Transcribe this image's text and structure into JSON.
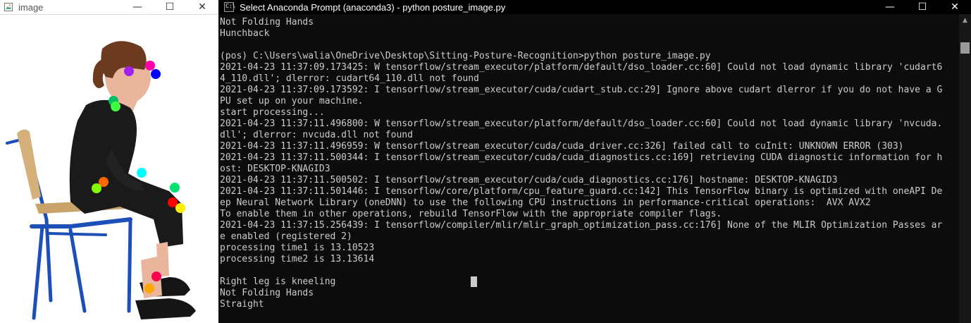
{
  "image_window": {
    "title": "image",
    "controls": {
      "minimize": "—",
      "maximize": "☐",
      "close": "✕"
    }
  },
  "console_window": {
    "title": "Select Anaconda Prompt (anaconda3) - python  posture_image.py",
    "icon_text": "C:\\",
    "controls": {
      "minimize": "—",
      "maximize": "☐",
      "close": "✕"
    },
    "lines": [
      "Not Folding Hands",
      "Hunchback",
      "",
      "(pos) C:\\Users\\walia\\OneDrive\\Desktop\\Sitting-Posture-Recognition>python posture_image.py",
      "2021-04-23 11:37:09.173425: W tensorflow/stream_executor/platform/default/dso_loader.cc:60] Could not load dynamic library 'cudart6",
      "4_110.dll'; dlerror: cudart64_110.dll not found",
      "2021-04-23 11:37:09.173592: I tensorflow/stream_executor/cuda/cudart_stub.cc:29] Ignore above cudart dlerror if you do not have a G",
      "PU set up on your machine.",
      "start processing...",
      "2021-04-23 11:37:11.496800: W tensorflow/stream_executor/platform/default/dso_loader.cc:60] Could not load dynamic library 'nvcuda.",
      "dll'; dlerror: nvcuda.dll not found",
      "2021-04-23 11:37:11.496959: W tensorflow/stream_executor/cuda/cuda_driver.cc:326] failed call to cuInit: UNKNOWN ERROR (303)",
      "2021-04-23 11:37:11.500344: I tensorflow/stream_executor/cuda/cuda_diagnostics.cc:169] retrieving CUDA diagnostic information for h",
      "ost: DESKTOP-KNAGID3",
      "2021-04-23 11:37:11.500502: I tensorflow/stream_executor/cuda/cuda_diagnostics.cc:176] hostname: DESKTOP-KNAGID3",
      "2021-04-23 11:37:11.501446: I tensorflow/core/platform/cpu_feature_guard.cc:142] This TensorFlow binary is optimized with oneAPI De",
      "ep Neural Network Library (oneDNN) to use the following CPU instructions in performance-critical operations:  AVX AVX2",
      "To enable them in other operations, rebuild TensorFlow with the appropriate compiler flags.",
      "2021-04-23 11:37:15.256439: I tensorflow/compiler/mlir/mlir_graph_optimization_pass.cc:176] None of the MLIR Optimization Passes ar",
      "e enabled (registered 2)",
      "processing time1 is 13.10523",
      "processing time2 is 13.13614",
      "",
      "Right leg is kneeling",
      "Not Folding Hands",
      "Straight"
    ]
  },
  "scrollbar": {
    "up_arrow": "▲"
  },
  "colors": {
    "console_bg": "#0c0c0c",
    "console_text": "#cccccc",
    "keypoints": [
      "#ff00ff",
      "#8a2be2",
      "#0000ff",
      "#00d060",
      "#00ffff",
      "#ff6600",
      "#80ff00",
      "#ff0000",
      "#ffff00",
      "#ff0080",
      "#ffa500"
    ]
  }
}
